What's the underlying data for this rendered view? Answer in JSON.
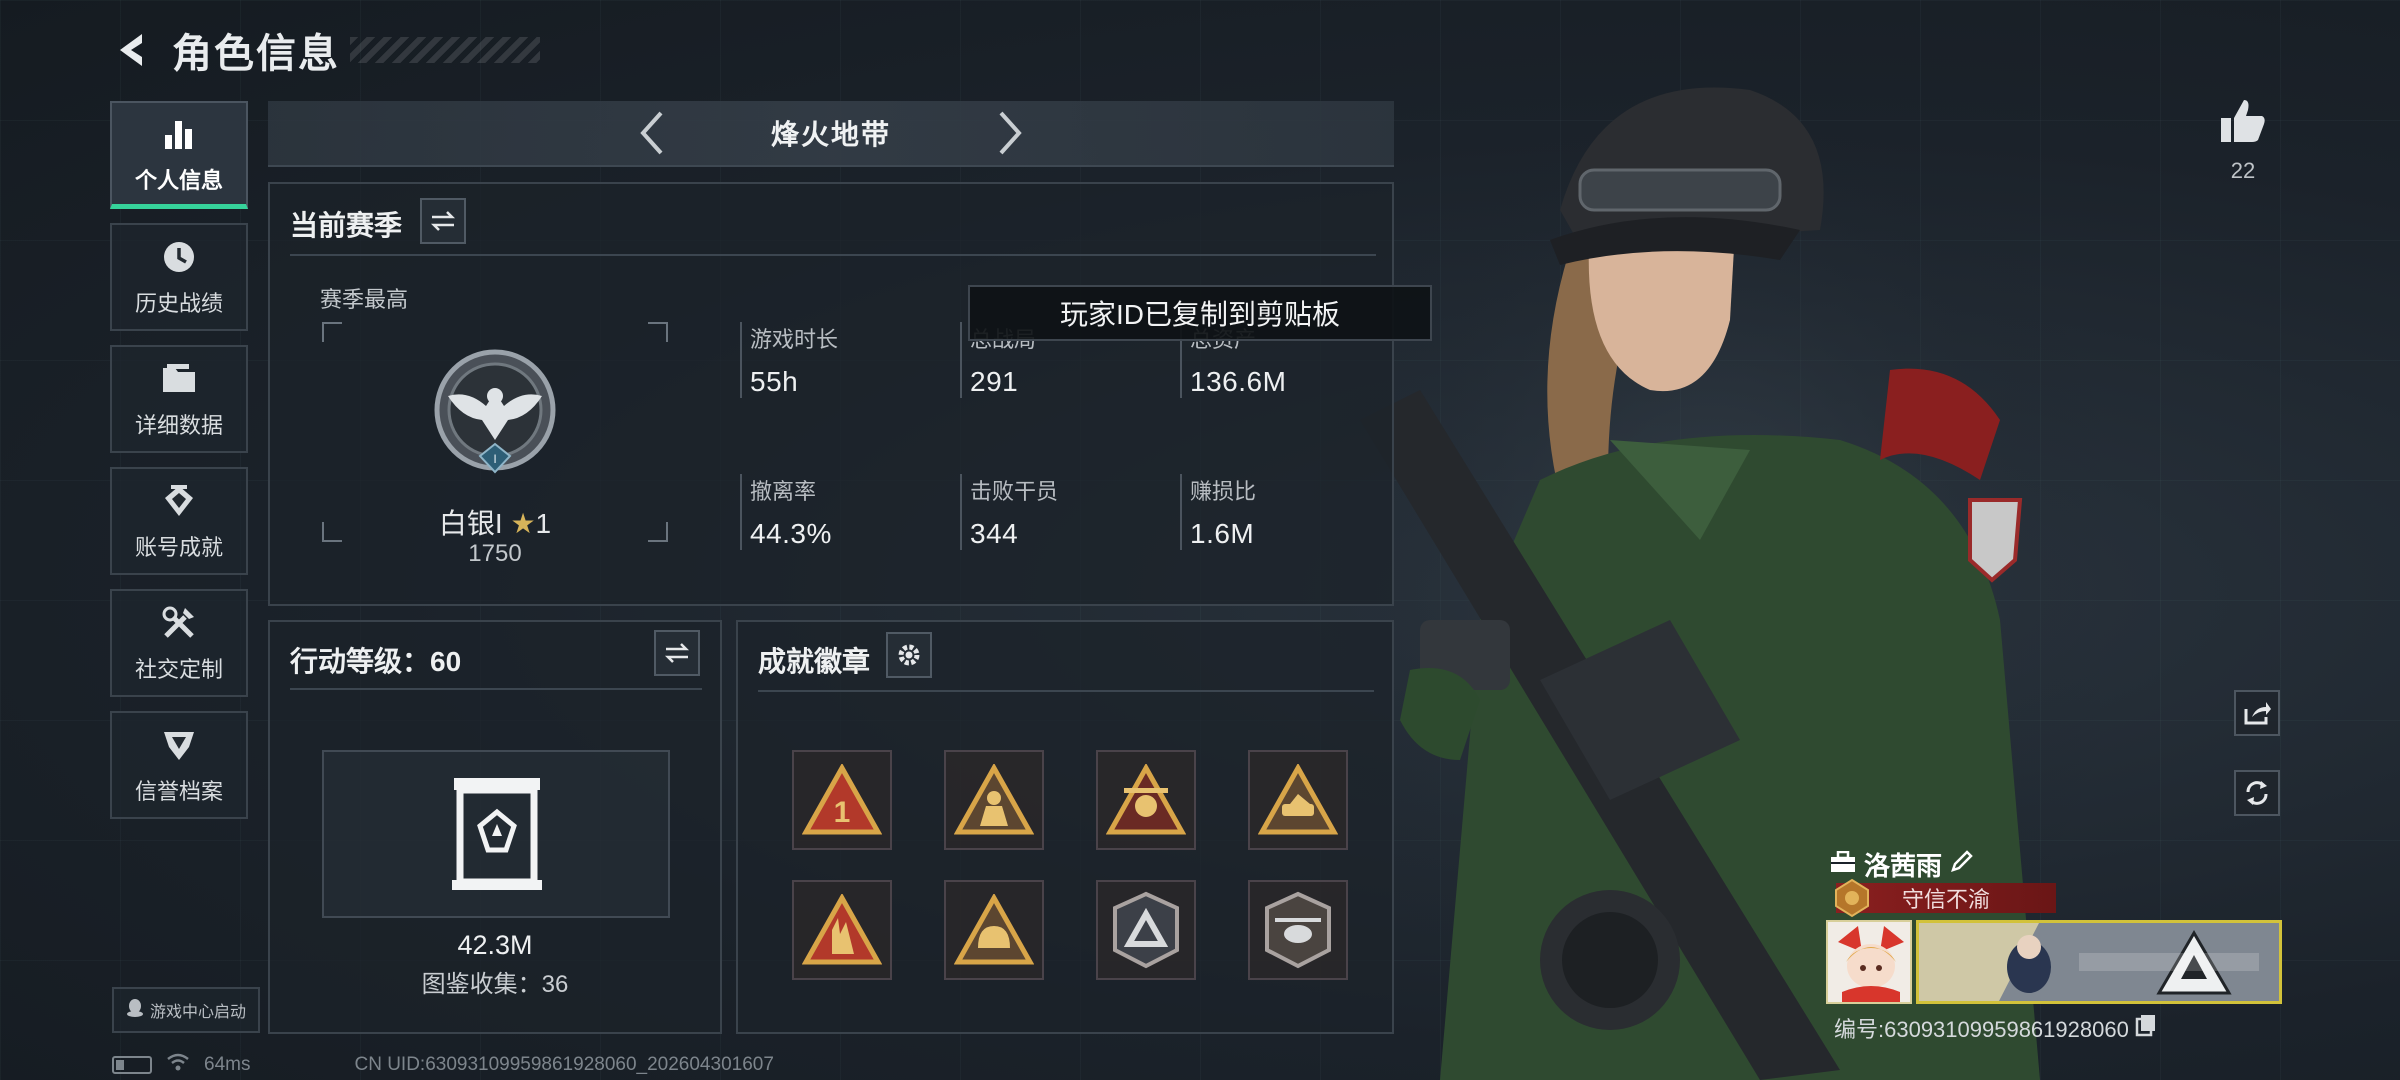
{
  "header": {
    "title": "角色信息"
  },
  "sidebar": {
    "items": [
      {
        "label": "个人信息",
        "icon": "bar-chart-icon",
        "active": true
      },
      {
        "label": "历史战绩",
        "icon": "history-icon",
        "active": false
      },
      {
        "label": "详细数据",
        "icon": "folder-icon",
        "active": false
      },
      {
        "label": "账号成就",
        "icon": "achievement-icon",
        "active": false
      },
      {
        "label": "社交定制",
        "icon": "tools-icon",
        "active": false
      },
      {
        "label": "信誉档案",
        "icon": "reputation-icon",
        "active": false
      }
    ],
    "game_center": "游戏中心启动"
  },
  "mode": {
    "title": "烽火地带"
  },
  "season": {
    "title": "当前赛季",
    "best_label": "赛季最高",
    "rank_name": "白银I",
    "rank_stars": "1",
    "rank_points": "1750",
    "stats": [
      {
        "label": "游戏时长",
        "value": "55h"
      },
      {
        "label": "总战局",
        "value": "291"
      },
      {
        "label": "总资产",
        "value": "136.6M"
      },
      {
        "label": "撤离率",
        "value": "44.3%"
      },
      {
        "label": "击败干员",
        "value": "344"
      },
      {
        "label": "赚损比",
        "value": "1.6M"
      }
    ]
  },
  "toast": "玩家ID已复制到剪贴板",
  "level": {
    "title_label": "行动等级：",
    "level": "60",
    "value": "42.3M",
    "collect": "图鉴收集：36"
  },
  "badges": {
    "title": "成就徽章",
    "items": [
      "badge-rank-one",
      "badge-squad",
      "badge-skull",
      "badge-vehicle",
      "badge-hand-sign",
      "badge-helmet",
      "badge-triangle",
      "badge-helicopter"
    ]
  },
  "likes": {
    "count": "22"
  },
  "player": {
    "name": "洛茜雨",
    "title": "守信不渝",
    "uid_label": "编号:63093109959861928060"
  },
  "status": {
    "ping": "64ms",
    "uid_footer": "CN UID:63093109959861928060_202604301607"
  },
  "colors": {
    "accent": "#36d39b",
    "title_red": "#8a1f1f",
    "banner_gold": "#d2c23a"
  }
}
